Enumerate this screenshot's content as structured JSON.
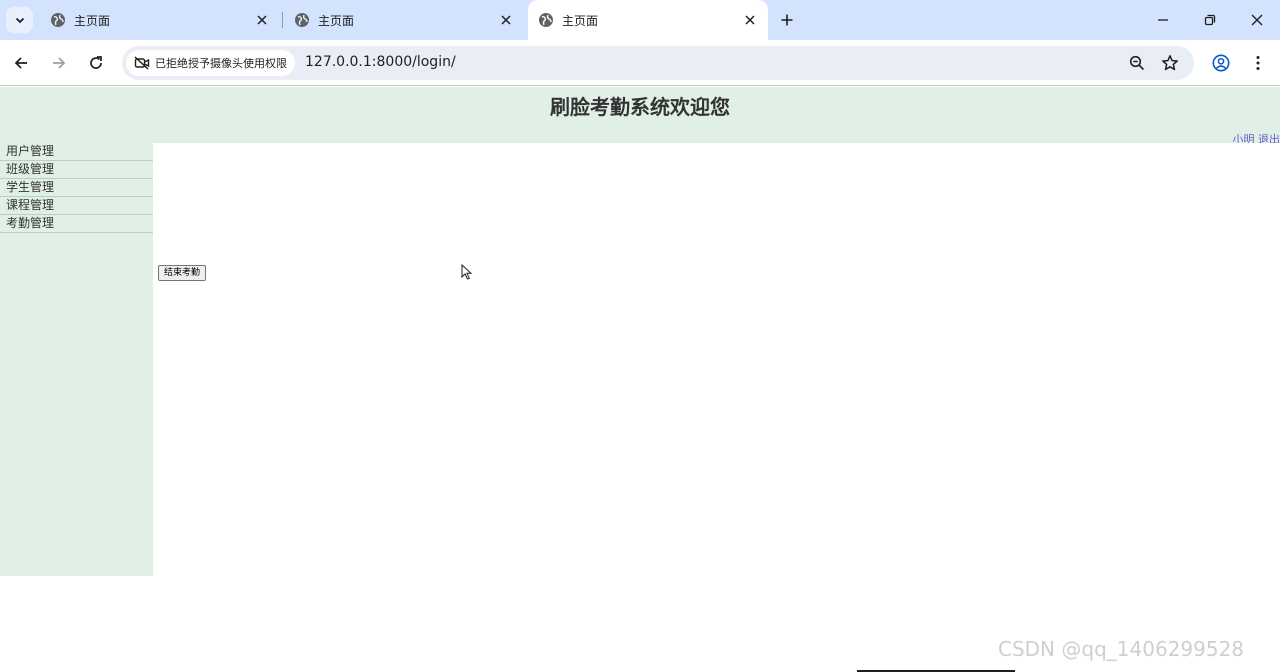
{
  "browser": {
    "tabs": [
      {
        "title": "主页面",
        "active": false
      },
      {
        "title": "主页面",
        "active": false
      },
      {
        "title": "主页面",
        "active": true
      }
    ],
    "permission_chip": "已拒绝授予摄像头使用权限",
    "url": "127.0.0.1:8000/login/"
  },
  "page": {
    "title": "刷脸考勤系统欢迎您",
    "user": "小明",
    "logout": "退出",
    "menu": [
      {
        "label": "用户管理"
      },
      {
        "label": "班级管理"
      },
      {
        "label": "学生管理"
      },
      {
        "label": "课程管理"
      },
      {
        "label": "考勤管理"
      }
    ],
    "end_attendance_button": "结束考勤"
  },
  "watermark": "CSDN @qq_1406299528",
  "colors": {
    "tabstrip": "#d3e3fd",
    "page_panel": "#e0f0e6",
    "link": "#6a5acd"
  }
}
